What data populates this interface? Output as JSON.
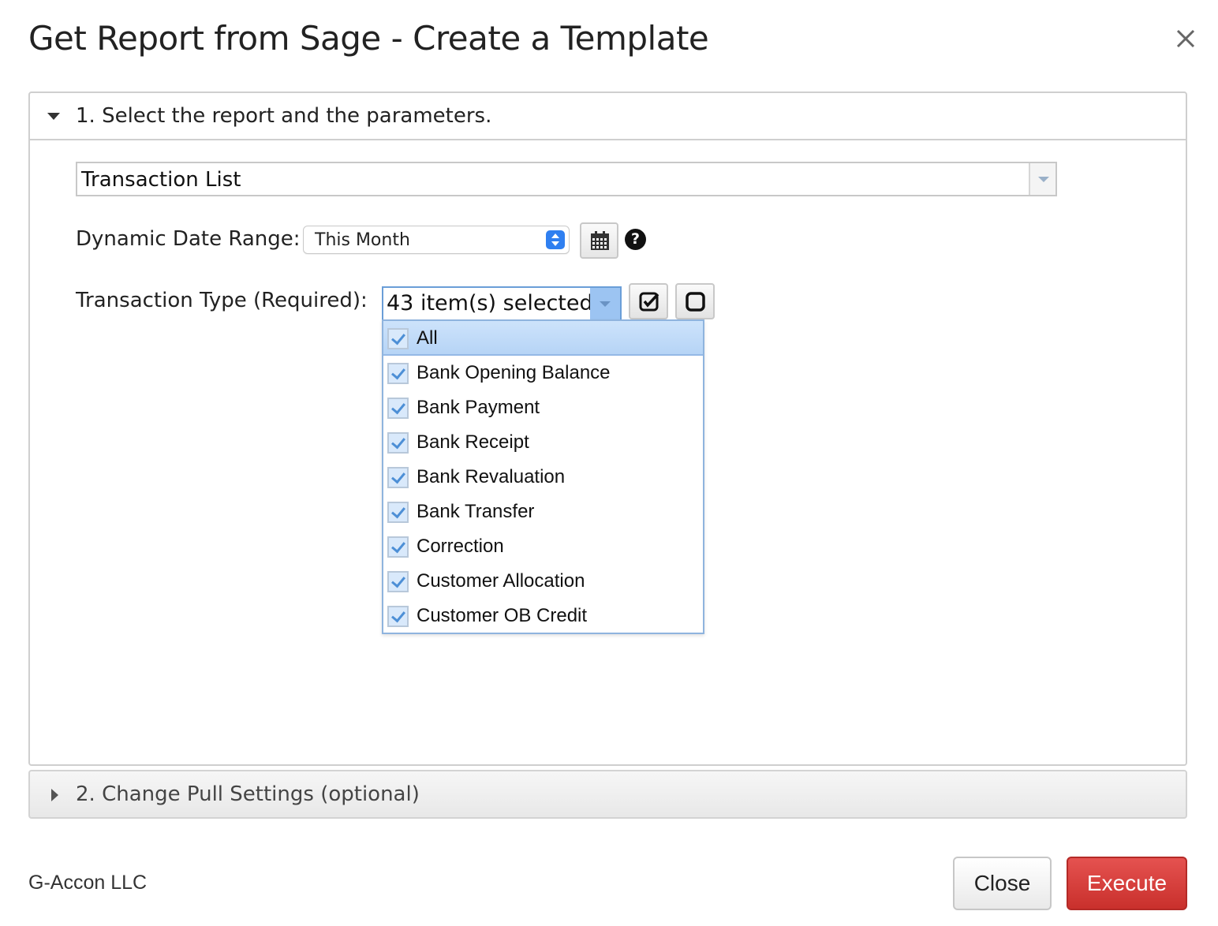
{
  "dialog": {
    "title": "Get Report from Sage - Create a Template"
  },
  "section1": {
    "header": "1. Select the report and the parameters.",
    "report_select": {
      "value": "Transaction List"
    },
    "dynamic_date_range": {
      "label": "Dynamic Date Range:",
      "value": "This Month"
    },
    "transaction_type": {
      "label": "Transaction Type (Required):",
      "summary": "43 item(s) selected",
      "options": [
        {
          "label": "All",
          "checked": true,
          "highlighted": true
        },
        {
          "label": "Bank Opening Balance",
          "checked": true
        },
        {
          "label": "Bank Payment",
          "checked": true
        },
        {
          "label": "Bank Receipt",
          "checked": true
        },
        {
          "label": "Bank Revaluation",
          "checked": true
        },
        {
          "label": "Bank Transfer",
          "checked": true
        },
        {
          "label": "Correction",
          "checked": true
        },
        {
          "label": "Customer Allocation",
          "checked": true
        },
        {
          "label": "Customer OB Credit",
          "checked": true
        }
      ]
    }
  },
  "section2": {
    "header": "2. Change Pull Settings (optional)"
  },
  "footer": {
    "company": "G-Accon LLC",
    "close_label": "Close",
    "execute_label": "Execute"
  },
  "colors": {
    "execute_bg": "#c9302c",
    "accent_blue": "#2f7ff0",
    "selection_blue": "#b6d4f6"
  },
  "icons": {
    "close": "close-icon",
    "calendar": "calendar-icon",
    "help": "help-icon",
    "select_all": "check-square-icon",
    "select_none": "square-icon"
  }
}
